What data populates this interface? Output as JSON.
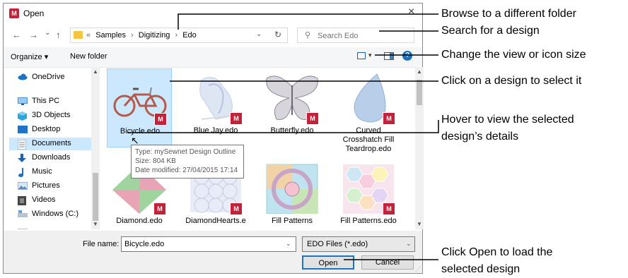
{
  "dialog": {
    "title": "Open",
    "app_icon": "mysewnet-logo-icon",
    "close_symbol": "×"
  },
  "nav": {
    "back": "←",
    "forward": "→",
    "recent": "⌄",
    "up": "↑",
    "breadcrumb_prefix": "«",
    "breadcrumbs": [
      "Samples",
      "Digitizing",
      "Edo"
    ],
    "breadcrumb_sep": "›",
    "address_dropdown": "⌄",
    "refresh": "↻",
    "search_placeholder": "Search Edo"
  },
  "toolbar": {
    "organize": "Organize ▾",
    "new_folder": "New folder",
    "view_dropdown": "▾",
    "help": "?"
  },
  "sidebar": {
    "items": [
      {
        "label": "OneDrive",
        "icon": "cloud-icon",
        "color": "#1a73c5"
      },
      {
        "label": "This PC",
        "icon": "computer-icon",
        "color": "#4a90d9"
      },
      {
        "label": "3D Objects",
        "icon": "cube-icon",
        "color": "#2fa3dc"
      },
      {
        "label": "Desktop",
        "icon": "desktop-icon",
        "color": "#1f73c9"
      },
      {
        "label": "Documents",
        "icon": "document-icon",
        "color": "#9aa7b4"
      },
      {
        "label": "Downloads",
        "icon": "download-icon",
        "color": "#2060b0"
      },
      {
        "label": "Music",
        "icon": "music-icon",
        "color": "#1f6fc0"
      },
      {
        "label": "Pictures",
        "icon": "pictures-icon",
        "color": "#5a88bb"
      },
      {
        "label": "Videos",
        "icon": "video-icon",
        "color": "#444444"
      },
      {
        "label": "Windows (C:)",
        "icon": "drive-icon",
        "color": "#6a9fd4"
      }
    ],
    "selected": "Documents"
  },
  "files": [
    {
      "name": "Bicycle.edo",
      "thumb": "bicycle-thumbnail",
      "selected": true
    },
    {
      "name": "Blue Jay.edo",
      "thumb": "bluejay-thumbnail",
      "selected": false
    },
    {
      "name": "Butterfly.edo",
      "thumb": "butterfly-thumbnail",
      "selected": false
    },
    {
      "name": "Curved Crosshatch Fill Teardrop.edo",
      "thumb": "teardrop-thumbnail",
      "selected": false
    },
    {
      "name": "Diamond.edo",
      "thumb": "diamond-thumbnail",
      "selected": false
    },
    {
      "name": "DiamondHearts.e",
      "thumb": "diamondhearts-thumbnail",
      "selected": false
    },
    {
      "name": "Fill Patterns",
      "thumb": "fillpatterns-thumbnail",
      "selected": false
    },
    {
      "name": "Fill Patterns.edo",
      "thumb": "fillpatterns2-thumbnail",
      "selected": false
    }
  ],
  "tooltip": {
    "type": "Type: mySewnet Design Outline",
    "size": "Size: 804 KB",
    "date": "Date modified: 27/04/2015 17:14"
  },
  "bottom": {
    "file_name_label": "File name:",
    "file_name_value": "Bicycle.edo",
    "file_type_value": "EDO Files (*.edo)",
    "open_button": "Open",
    "cancel_button": "Cancel"
  },
  "callouts": {
    "browse": "Browse to a different folder",
    "search": "Search for a design",
    "view": "Change the view or icon size",
    "click": "Click on a design to select it",
    "hover_line1": "Hover to view the selected",
    "hover_line2": "design’s details",
    "open_line1": "Click Open to load the",
    "open_line2": "selected design"
  },
  "colors": {
    "accent": "#1a73c5",
    "selection": "#cce8ff",
    "badge": "#c4223a"
  }
}
